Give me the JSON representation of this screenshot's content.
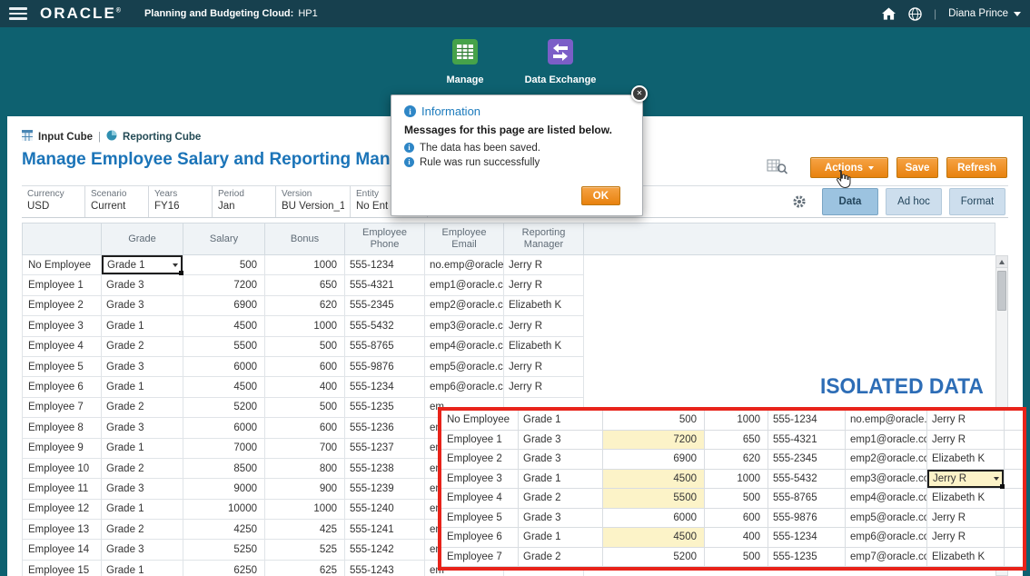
{
  "topbar": {
    "brand": "ORACLE",
    "brand_mark": "®",
    "product": "Planning and Budgeting Cloud:",
    "environment": "HP1",
    "user": "Diana Prince"
  },
  "nav": {
    "items": [
      {
        "label": "Manage"
      },
      {
        "label": "Data Exchange"
      }
    ]
  },
  "dialog": {
    "title": "Information",
    "heading": "Messages for this page are listed below.",
    "messages": [
      {
        "text": "The data has been saved."
      },
      {
        "text": "Rule was run successfully"
      }
    ],
    "ok_label": "OK"
  },
  "page": {
    "breadcrumb": {
      "input_cube": "Input Cube",
      "separator": "|",
      "reporting_cube": "Reporting Cube"
    },
    "title": "Manage Employee Salary and Reporting Man",
    "toolbar": {
      "actions_label": "Actions",
      "save_label": "Save",
      "refresh_label": "Refresh"
    },
    "tabs": [
      {
        "label": "Data",
        "selected": true
      },
      {
        "label": "Ad hoc",
        "selected": false
      },
      {
        "label": "Format",
        "selected": false
      }
    ]
  },
  "pov": {
    "members": [
      {
        "label": "Currency",
        "value": "USD"
      },
      {
        "label": "Scenario",
        "value": "Current"
      },
      {
        "label": "Years",
        "value": "FY16"
      },
      {
        "label": "Period",
        "value": "Jan"
      },
      {
        "label": "Version",
        "value": "BU Version_1"
      },
      {
        "label": "Entity",
        "value": "No Ent"
      }
    ]
  },
  "grid": {
    "columns": [
      "",
      "Grade",
      "Salary",
      "Bonus",
      "Employee Phone",
      "Employee Email",
      "Reporting Manager"
    ],
    "rows": [
      {
        "name": "No Employee",
        "grade": "Grade 1",
        "salary": "500",
        "bonus": "1000",
        "phone": "555-1234",
        "email": "no.emp@oracle.c",
        "manager": "Jerry R",
        "grade_dropdown": true
      },
      {
        "name": "Employee 1",
        "grade": "Grade 3",
        "salary": "7200",
        "bonus": "650",
        "phone": "555-4321",
        "email": "emp1@oracle.co",
        "manager": "Jerry R"
      },
      {
        "name": "Employee 2",
        "grade": "Grade 3",
        "salary": "6900",
        "bonus": "620",
        "phone": "555-2345",
        "email": "emp2@oracle.co",
        "manager": "Elizabeth K"
      },
      {
        "name": "Employee 3",
        "grade": "Grade 1",
        "salary": "4500",
        "bonus": "1000",
        "phone": "555-5432",
        "email": "emp3@oracle.co",
        "manager": "Jerry R"
      },
      {
        "name": "Employee 4",
        "grade": "Grade 2",
        "salary": "5500",
        "bonus": "500",
        "phone": "555-8765",
        "email": "emp4@oracle.co",
        "manager": "Elizabeth K"
      },
      {
        "name": "Employee 5",
        "grade": "Grade 3",
        "salary": "6000",
        "bonus": "600",
        "phone": "555-9876",
        "email": "emp5@oracle.co",
        "manager": "Jerry R"
      },
      {
        "name": "Employee 6",
        "grade": "Grade 1",
        "salary": "4500",
        "bonus": "400",
        "phone": "555-1234",
        "email": "emp6@oracle.co",
        "manager": "Jerry R"
      },
      {
        "name": "Employee 7",
        "grade": "Grade 2",
        "salary": "5200",
        "bonus": "500",
        "phone": "555-1235",
        "email": "em",
        "manager": ""
      },
      {
        "name": "Employee 8",
        "grade": "Grade 3",
        "salary": "6000",
        "bonus": "600",
        "phone": "555-1236",
        "email": "em",
        "manager": ""
      },
      {
        "name": "Employee 9",
        "grade": "Grade 1",
        "salary": "7000",
        "bonus": "700",
        "phone": "555-1237",
        "email": "em",
        "manager": ""
      },
      {
        "name": "Employee 10",
        "grade": "Grade 2",
        "salary": "8500",
        "bonus": "800",
        "phone": "555-1238",
        "email": "em",
        "manager": ""
      },
      {
        "name": "Employee 11",
        "grade": "Grade 3",
        "salary": "9000",
        "bonus": "900",
        "phone": "555-1239",
        "email": "em",
        "manager": ""
      },
      {
        "name": "Employee 12",
        "grade": "Grade 1",
        "salary": "10000",
        "bonus": "1000",
        "phone": "555-1240",
        "email": "em",
        "manager": ""
      },
      {
        "name": "Employee 13",
        "grade": "Grade 2",
        "salary": "4250",
        "bonus": "425",
        "phone": "555-1241",
        "email": "em",
        "manager": ""
      },
      {
        "name": "Employee 14",
        "grade": "Grade 3",
        "salary": "5250",
        "bonus": "525",
        "phone": "555-1242",
        "email": "em",
        "manager": ""
      },
      {
        "name": "Employee 15",
        "grade": "Grade 1",
        "salary": "6250",
        "bonus": "625",
        "phone": "555-1243",
        "email": "em",
        "manager": ""
      }
    ]
  },
  "isolated": {
    "caption": "ISOLATED DATA",
    "rows": [
      {
        "name": "No Employee",
        "grade": "Grade 1",
        "salary": "500",
        "bonus": "1000",
        "phone": "555-1234",
        "email": "no.emp@oracle.c",
        "manager": "Jerry R"
      },
      {
        "name": "Employee 1",
        "grade": "Grade 3",
        "salary": "7200",
        "bonus": "650",
        "phone": "555-4321",
        "email": "emp1@oracle.co",
        "manager": "Jerry R",
        "salary_highlight": true
      },
      {
        "name": "Employee 2",
        "grade": "Grade 3",
        "salary": "6900",
        "bonus": "620",
        "phone": "555-2345",
        "email": "emp2@oracle.co",
        "manager": "Elizabeth K"
      },
      {
        "name": "Employee 3",
        "grade": "Grade 1",
        "salary": "4500",
        "bonus": "1000",
        "phone": "555-5432",
        "email": "emp3@oracle.co",
        "manager": "Jerry R",
        "salary_highlight": true,
        "manager_dropdown": true
      },
      {
        "name": "Employee 4",
        "grade": "Grade 2",
        "salary": "5500",
        "bonus": "500",
        "phone": "555-8765",
        "email": "emp4@oracle.co",
        "manager": "Elizabeth K",
        "salary_highlight": true
      },
      {
        "name": "Employee 5",
        "grade": "Grade 3",
        "salary": "6000",
        "bonus": "600",
        "phone": "555-9876",
        "email": "emp5@oracle.co",
        "manager": "Jerry R"
      },
      {
        "name": "Employee 6",
        "grade": "Grade 1",
        "salary": "4500",
        "bonus": "400",
        "phone": "555-1234",
        "email": "emp6@oracle.co",
        "manager": "Jerry R",
        "salary_highlight": true
      },
      {
        "name": "Employee 7",
        "grade": "Grade 2",
        "salary": "5200",
        "bonus": "500",
        "phone": "555-1235",
        "email": "emp7@oracle.co",
        "manager": "Elizabeth K"
      }
    ]
  },
  "colors": {
    "topbar_navy": "#17404e",
    "banner_teal": "#0e6170",
    "accent_orange": "#e8820e",
    "title_blue": "#1b74b8",
    "tab_selected_blue": "#9cc3e0",
    "highlight_yellow": "#fcf3c8",
    "annotation_red": "#e8231a"
  }
}
